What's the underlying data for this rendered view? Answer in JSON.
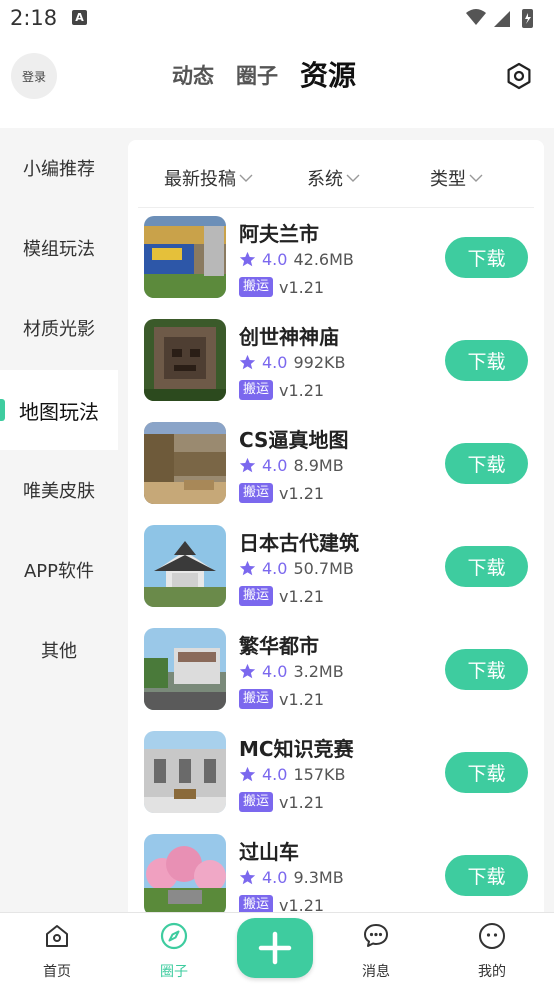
{
  "status_bar": {
    "time": "2:18",
    "notification_icon": "A"
  },
  "header": {
    "login_label": "登录",
    "tabs": [
      {
        "label": "动态",
        "active": false
      },
      {
        "label": "圈子",
        "active": false
      },
      {
        "label": "资源",
        "active": true
      }
    ],
    "settings_icon": "hexagon-settings-icon"
  },
  "sidebar": {
    "items": [
      {
        "label": "小编推荐",
        "active": false
      },
      {
        "label": "模组玩法",
        "active": false
      },
      {
        "label": "材质光影",
        "active": false
      },
      {
        "label": "地图玩法",
        "active": true
      },
      {
        "label": "唯美皮肤",
        "active": false
      },
      {
        "label": "APP软件",
        "active": false
      },
      {
        "label": "其他",
        "active": false
      }
    ]
  },
  "filters": [
    {
      "label": "最新投稿"
    },
    {
      "label": "系统"
    },
    {
      "label": "类型"
    }
  ],
  "resources": [
    {
      "title": "阿夫兰市",
      "rating": "4.0",
      "size": "42.6MB",
      "tag": "搬运",
      "version": "v1.21",
      "download_label": "下载"
    },
    {
      "title": "创世神神庙",
      "rating": "4.0",
      "size": "992KB",
      "tag": "搬运",
      "version": "v1.21",
      "download_label": "下载"
    },
    {
      "title": "CS逼真地图",
      "rating": "4.0",
      "size": "8.9MB",
      "tag": "搬运",
      "version": "v1.21",
      "download_label": "下载"
    },
    {
      "title": "日本古代建筑",
      "rating": "4.0",
      "size": "50.7MB",
      "tag": "搬运",
      "version": "v1.21",
      "download_label": "下载"
    },
    {
      "title": "繁华都市",
      "rating": "4.0",
      "size": "3.2MB",
      "tag": "搬运",
      "version": "v1.21",
      "download_label": "下载"
    },
    {
      "title": "MC知识竞赛",
      "rating": "4.0",
      "size": "157KB",
      "tag": "搬运",
      "version": "v1.21",
      "download_label": "下载"
    },
    {
      "title": "过山车",
      "rating": "4.0",
      "size": "9.3MB",
      "tag": "搬运",
      "version": "v1.21",
      "download_label": "下载"
    }
  ],
  "bottom_nav": [
    {
      "label": "首页",
      "icon": "home-icon",
      "active": false
    },
    {
      "label": "圈子",
      "icon": "compass-icon",
      "active": true
    },
    {
      "label": "消息",
      "icon": "chat-icon",
      "active": false
    },
    {
      "label": "我的",
      "icon": "profile-icon",
      "active": false
    }
  ],
  "colors": {
    "accent": "#3ecc9f",
    "rating": "#7b68ee",
    "tag_bg": "#7b68ee"
  }
}
